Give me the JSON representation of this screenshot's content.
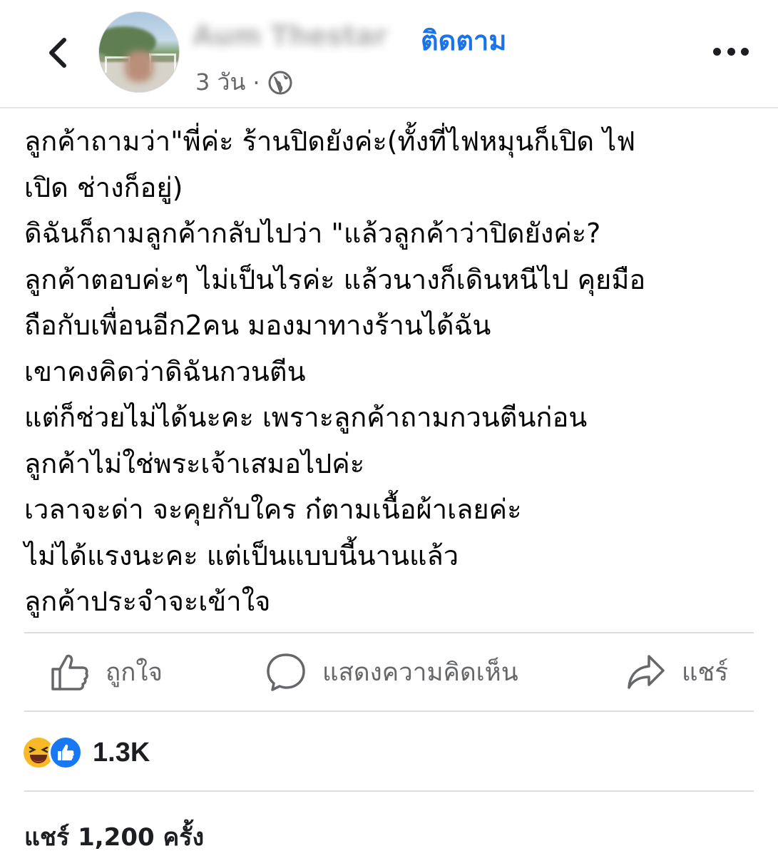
{
  "header": {
    "author_name": "Aum Thestar",
    "follow_label": "ติดตาม",
    "timestamp": "3 วัน",
    "dot": "·",
    "privacy_icon": "globe-icon",
    "back_icon": "chevron-left-icon",
    "more_icon": "more-dots-icon"
  },
  "post": {
    "lines": [
      "ลูกค้าถามว่า\"พี่ค่ะ ร้านปิดยังค่ะ(ทั้งที่ไฟหมุนก็เปิด ไฟ",
      "เปิด ช่างก็อยู่)",
      "ดิฉันก็ถามลูกค้ากลับไปว่า \"แล้วลูกค้าว่าปิดยังค่ะ?",
      "ลูกค้าตอบค่ะๆ ไม่เป็นไรค่ะ แล้วนางก็เดินหนีไป คุยมือ",
      "ถือกับเพื่อนอีก2คน มองมาทางร้านได้ฉัน",
      "เขาคงคิดว่าดิฉันกวนตีน",
      "แต่ก็ช่วยไม่ได้นะคะ เพราะลูกค้าถามกวนตีนก่อน",
      "ลูกค้าไม่ใช่พระเจ้าเสมอไปค่ะ",
      "เวลาจะด่า จะคุยกับใคร ก๋ตามเนื้อผ้าเลยค่ะ",
      "ไม่ได้แรงนะคะ แต่เป็นแบบนี้นานแล้ว",
      "ลูกค้าประจำจะเข้าใจ"
    ]
  },
  "actions": {
    "like_label": "ถูกใจ",
    "comment_label": "แสดงความคิดเห็น",
    "share_label": "แชร์"
  },
  "reactions": {
    "emojis": [
      "haha-emoji",
      "like-emoji"
    ],
    "count": "1.3K"
  },
  "shares": {
    "text": "แชร์ 1,200 ครั้ง"
  },
  "colors": {
    "follow": "#1a73e8",
    "secondary_text": "#65676b",
    "like_blue": "#1877f2",
    "haha_yellow": "#f7b928"
  }
}
